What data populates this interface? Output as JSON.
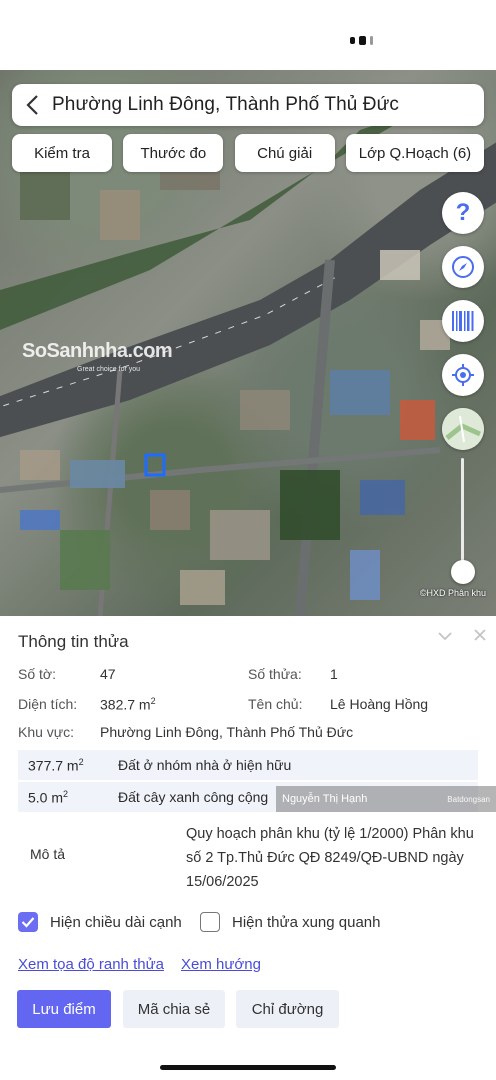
{
  "header": {
    "title": "Phường Linh Đông, Thành Phố Thủ Đức"
  },
  "toolbar": {
    "check": "Kiểm tra",
    "measure": "Thước đo",
    "legend": "Chú giải",
    "layer": "Lớp Q.Hoạch (6)"
  },
  "map": {
    "watermark_name": "SoSanhnha.com",
    "watermark_tagline": "Great choice for you",
    "attribution": "©HXD Phân khu",
    "side_icons": [
      "help-icon",
      "compass-icon",
      "barcode-icon",
      "locate-icon",
      "map-layer-icon"
    ]
  },
  "panel": {
    "title": "Thông tin thửa",
    "so_to_label": "Số tờ:",
    "so_to_value": "47",
    "so_thua_label": "Số thửa:",
    "so_thua_value": "1",
    "dien_tich_label": "Diện tích:",
    "dien_tich_value": "382.7 m",
    "dien_tich_unit": "2",
    "ten_chu_label": "Tên chủ:",
    "ten_chu_value": "Lê Hoàng Hồng",
    "khu_vuc_label": "Khu vực:",
    "khu_vuc_value": "Phường Linh Đông, Thành Phố Thủ Đức",
    "allocations": [
      {
        "area": "377.7 m",
        "unit": "2",
        "desc": "Đất ở nhóm nhà ở hiện hữu"
      },
      {
        "area": "5.0 m",
        "unit": "2",
        "desc": "Đất cây xanh công cộng"
      }
    ],
    "mo_ta_label": "Mô tả",
    "mo_ta_value": "Quy hoạch phân khu (tỷ lệ 1/2000) Phân khu số 2 Tp.Thủ Đức QĐ 8249/QĐ-UBND ngày 15/06/2025",
    "overlay_name": "Nguyễn Thị Hạnh",
    "overlay_logo": "Batdongsan",
    "show_edge_length": "Hiện chiều dài cạnh",
    "show_edge_length_checked": true,
    "show_neighbors": "Hiện thửa xung quanh",
    "show_neighbors_checked": false,
    "link_coords": "Xem tọa độ ranh thửa",
    "link_direction": "Xem hướng",
    "btn_save": "Lưu điểm",
    "btn_share": "Mã chia sẻ",
    "btn_route": "Chỉ đường"
  },
  "colors": {
    "accent": "#6366f1",
    "link": "#4a4cd8",
    "parcel_outline": "#1e6bff"
  }
}
